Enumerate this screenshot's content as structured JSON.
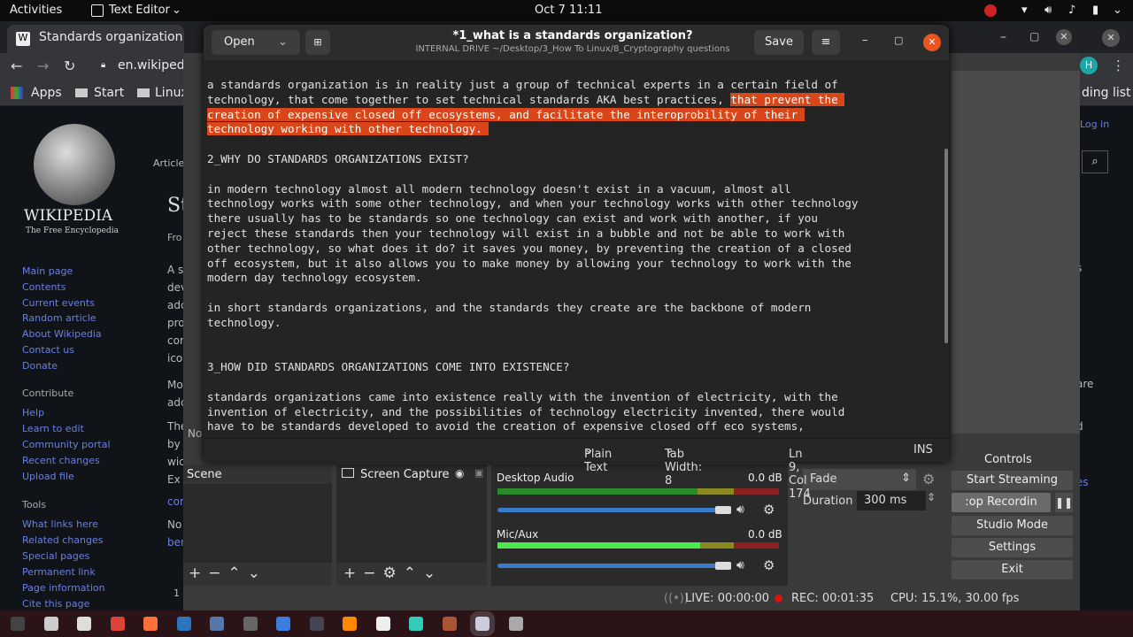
{
  "topbar": {
    "activities": "Activities",
    "app": "Text Editor",
    "app_chevron": "⌄",
    "clock": "Oct 7  11:11"
  },
  "chrome": {
    "tab_title": "Standards organization -",
    "url": "en.wikipedia",
    "bookmarks": [
      "Apps",
      "Start",
      "Linux"
    ],
    "reading_list": "ding list",
    "avatar": "H"
  },
  "wiki": {
    "logo_title": "WIKIPEDIA",
    "logo_subtitle": "The Free Encyclopedia",
    "article_tab": "Article",
    "title_frag": "St",
    "from_frag": "Fro",
    "login": "Log in",
    "nav": [
      "Main page",
      "Contents",
      "Current events",
      "Random article",
      "About Wikipedia",
      "Contact us",
      "Donate"
    ],
    "contribute_heading": "Contribute",
    "contribute": [
      "Help",
      "Learn to edit",
      "Community portal",
      "Recent changes",
      "Upload file"
    ],
    "tools_heading": "Tools",
    "tools": [
      "What links here",
      "Related changes",
      "Special pages",
      "Permanent link",
      "Page information",
      "Cite this page"
    ],
    "body_frags": [
      "A s",
      "dev",
      "adc",
      "pro",
      "cor",
      "ico",
      "Mo",
      "adc",
      "The",
      "by",
      "wic",
      "Ex",
      "cor",
      "No",
      "ber"
    ],
    "right_frags": [
      "s",
      "are",
      "d",
      "es"
    ],
    "table_num": "1",
    "overlap_frag": "No"
  },
  "editor": {
    "open": "Open",
    "title": "*1_what is a standards organization?",
    "subtitle": "INTERNAL DRIVE ~/Desktop/3_How To Linux/8_Cryptography questions",
    "save": "Save",
    "menu_icon": "≡",
    "lines": [
      {
        "t": "a standards organization is in reality just a group of technical experts in a certain field of"
      },
      {
        "t": "technology, that come together to set technical standards AKA best practices, ",
        "h": "that prevent the "
      },
      {
        "h": "creation of expensive closed off ecosystems, and facilitate the interoprobility of their "
      },
      {
        "h": "technology working with other technology. "
      },
      {
        "t": ""
      },
      {
        "t": "2_WHY DO STANDARDS ORGANIZATIONS EXIST?"
      },
      {
        "t": ""
      },
      {
        "t": "in modern technology almost all modern technology doesn't exist in a vacuum, almost all"
      },
      {
        "t": "technology works with some other technology, and when your technology works with other technology"
      },
      {
        "t": "there usually has to be standards so one technology can exist and work with another, if you"
      },
      {
        "t": "reject these standards then your technology will exist in a bubble and not be able to work with"
      },
      {
        "t": "other technology, so what does it do? it saves you money, by preventing the creation of a closed"
      },
      {
        "t": "off ecosystem, but it also allows you to make money by allowing your technology to work with the"
      },
      {
        "t": "modern day technology ecosystem."
      },
      {
        "t": ""
      },
      {
        "t": "in short standards organizations, and the standards they create are the backbone of modern"
      },
      {
        "t": "technology."
      },
      {
        "t": ""
      },
      {
        "t": ""
      },
      {
        "t": "3_HOW DID STANDARDS ORGANIZATIONS COME INTO EXISTENCE?"
      },
      {
        "t": ""
      },
      {
        "t": "standards organizations came into existence really with the invention of electricity, with the"
      },
      {
        "t": "invention of electricity, and the possibilities of technology electricity invented, there would"
      },
      {
        "t": "have to be standards developed to avoid the creation of expensive closed off eco systems,"
      }
    ],
    "status": {
      "language": "Plain Text",
      "tab_width": "Tab Width: 8",
      "position": "Ln 9, Col 174",
      "mode": "INS"
    }
  },
  "obs": {
    "scene": "Scene",
    "source": "Screen Capture",
    "audio": [
      {
        "name": "Desktop Audio",
        "db": "0.0 dB",
        "level": 0
      },
      {
        "name": "Mic/Aux",
        "db": "0.0 dB",
        "level": 0.72
      }
    ],
    "transition": "Fade",
    "duration_label": "Duration",
    "duration": "300 ms",
    "controls_title": "Controls",
    "controls": [
      "Start Streaming",
      ":op Recordin",
      "Studio Mode",
      "Settings",
      "Exit"
    ],
    "live": "LIVE: 00:00:00",
    "rec": "REC: 00:01:35",
    "cpu": "CPU: 15.1%, 30.00 fps"
  },
  "colors": {
    "selection": "#d9461a",
    "close": "#e95420",
    "rec": "#e01010"
  }
}
